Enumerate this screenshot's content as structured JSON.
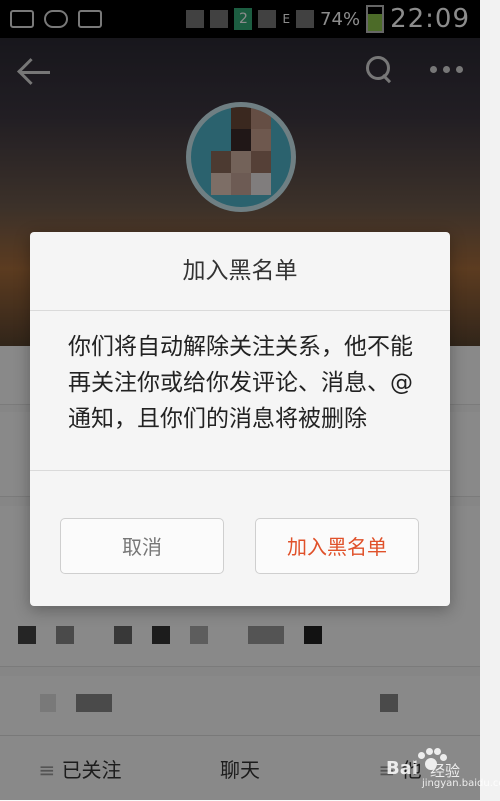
{
  "status_bar": {
    "battery": "74%",
    "time": "22:09",
    "sim_badge": "2",
    "network_letter": "E"
  },
  "page": {
    "bottom_bar": {
      "follow_label": "已关注",
      "chat_label": "聊天",
      "more_label": "他"
    }
  },
  "dialog": {
    "title": "加入黑名单",
    "message": "你们将自动解除关注关系，他不能再关注你或给你发评论、消息、@通知，且你们的消息将被删除",
    "cancel_label": "取消",
    "confirm_label": "加入黑名单"
  },
  "watermark": {
    "brand": "Bai",
    "sub": "经验",
    "url": "jingyan.baidu.com"
  },
  "colors": {
    "accent": "#e0512a",
    "status_bar": "#000000",
    "dialog_bg": "#f5f5f5"
  }
}
